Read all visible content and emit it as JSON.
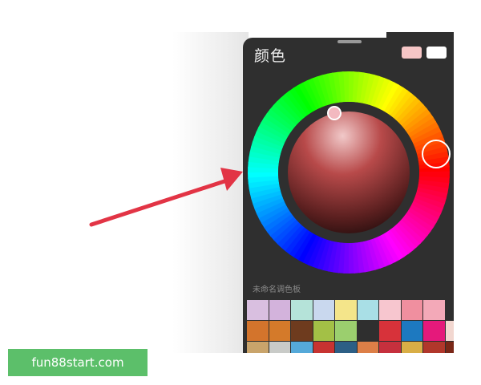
{
  "panel": {
    "title": "颜色",
    "primary_color": "#f6c6c6",
    "secondary_color": "#ffffff"
  },
  "palette": {
    "label": "未命名调色板",
    "swatches": [
      "#d9bfe0",
      "#d3b3dc",
      "#b5e3d9",
      "#c9d8ee",
      "#f4e58a",
      "#a9dfe6",
      "#f7c6cf",
      "#f08f9f",
      "#f3a9b8",
      "#2f2f2f",
      "#d3742c",
      "#d47a2a",
      "#6e3b1e",
      "#a3c046",
      "#9bcf6e",
      "#2f2f2f",
      "#d7323a",
      "#1d79c0",
      "#e5197b",
      "#f2d7d0",
      "#c9a46b",
      "#c9cbc8",
      "#55a9d9",
      "#c73331",
      "#2d5f85",
      "#dd7f47",
      "#c6303d",
      "#d9ae46",
      "#b1372b",
      "#7a2717"
    ]
  },
  "annotation": {
    "arrow_color": "#e23445"
  },
  "watermark": {
    "text": "fun88start.com"
  }
}
